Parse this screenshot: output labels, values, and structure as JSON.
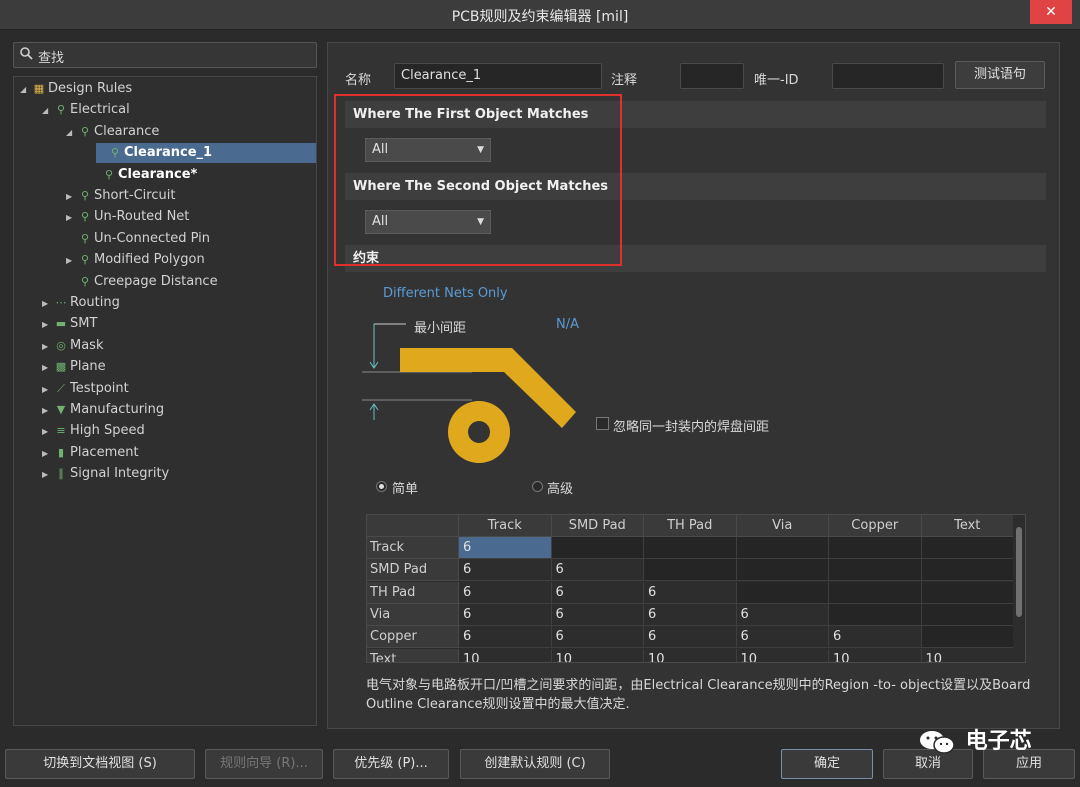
{
  "window": {
    "title": "PCB规则及约束编辑器 [mil]",
    "close_glyph": "✕"
  },
  "search": {
    "label": "查找"
  },
  "tree": [
    {
      "label": "Design Rules",
      "arrow": "◢",
      "icon": "folder"
    },
    {
      "label": "Electrical",
      "arrow": "◢",
      "icon": "rule"
    },
    {
      "label": "Clearance",
      "arrow": "◢",
      "icon": "rule"
    },
    {
      "label": "Clearance_1",
      "arrow": "",
      "icon": "rule"
    },
    {
      "label": "Clearance*",
      "arrow": "",
      "icon": "rule"
    },
    {
      "label": "Short-Circuit",
      "arrow": "▶",
      "icon": "rule"
    },
    {
      "label": "Un-Routed Net",
      "arrow": "▶",
      "icon": "rule"
    },
    {
      "label": "Un-Connected Pin",
      "arrow": "",
      "icon": "rule"
    },
    {
      "label": "Modified Polygon",
      "arrow": "▶",
      "icon": "rule"
    },
    {
      "label": "Creepage Distance",
      "arrow": "",
      "icon": "rule"
    },
    {
      "label": "Routing",
      "arrow": "▶",
      "icon": "routing"
    },
    {
      "label": "SMT",
      "arrow": "▶",
      "icon": "smt"
    },
    {
      "label": "Mask",
      "arrow": "▶",
      "icon": "mask"
    },
    {
      "label": "Plane",
      "arrow": "▶",
      "icon": "plane"
    },
    {
      "label": "Testpoint",
      "arrow": "▶",
      "icon": "testpoint"
    },
    {
      "label": "Manufacturing",
      "arrow": "▶",
      "icon": "manufacturing"
    },
    {
      "label": "High Speed",
      "arrow": "▶",
      "icon": "highspeed"
    },
    {
      "label": "Placement",
      "arrow": "▶",
      "icon": "placement"
    },
    {
      "label": "Signal Integrity",
      "arrow": "▶",
      "icon": "signal"
    }
  ],
  "form": {
    "name_label": "名称",
    "name_value": "Clearance_1",
    "comment_label": "注释",
    "comment_value": "",
    "id_label": "唯一-ID",
    "id_value": "",
    "test_button": "测试语句"
  },
  "sections": {
    "first": "Where The First Object Matches",
    "second": "Where The Second Object Matches",
    "constraint": "约束"
  },
  "dropdowns": {
    "first_value": "All",
    "second_value": "All"
  },
  "constraint": {
    "net_scope": "Different Nets Only",
    "min_clearance_label": "最小间距",
    "min_clearance_value": "N/A",
    "ignore_pad_label": "忽略同一封装内的焊盘间距",
    "mode_simple": "简单",
    "mode_advanced": "高级"
  },
  "table": {
    "columns": [
      "Track",
      "SMD Pad",
      "TH Pad",
      "Via",
      "Copper",
      "Text"
    ],
    "rows": [
      {
        "label": "Track",
        "values": [
          "6",
          "",
          "",
          "",
          "",
          ""
        ]
      },
      {
        "label": "SMD Pad",
        "values": [
          "6",
          "6",
          "",
          "",
          "",
          ""
        ]
      },
      {
        "label": "TH Pad",
        "values": [
          "6",
          "6",
          "6",
          "",
          "",
          ""
        ]
      },
      {
        "label": "Via",
        "values": [
          "6",
          "6",
          "6",
          "6",
          "",
          ""
        ]
      },
      {
        "label": "Copper",
        "values": [
          "6",
          "6",
          "6",
          "6",
          "6",
          ""
        ]
      },
      {
        "label": "Text",
        "values": [
          "10",
          "10",
          "10",
          "10",
          "10",
          "10"
        ]
      }
    ]
  },
  "description": "电气对象与电路板开口/凹槽之间要求的间距，由Electrical Clearance规则中的Region -to- object设置以及Board Outline Clearance规则设置中的最大值决定.",
  "footer": {
    "switch_view": "切换到文档视图 (S)",
    "rule_wizard": "规则向导 (R)...",
    "priority": "优先级 (P)...",
    "create_default": "创建默认规则 (C)",
    "ok": "确定",
    "cancel": "取消",
    "apply": "应用"
  },
  "watermark": {
    "text": "电子芯"
  },
  "colors": {
    "selection": "#4a6a90",
    "highlight_box": "#e0302e",
    "copper": "#e0a81c",
    "link": "#5b9bd5"
  }
}
